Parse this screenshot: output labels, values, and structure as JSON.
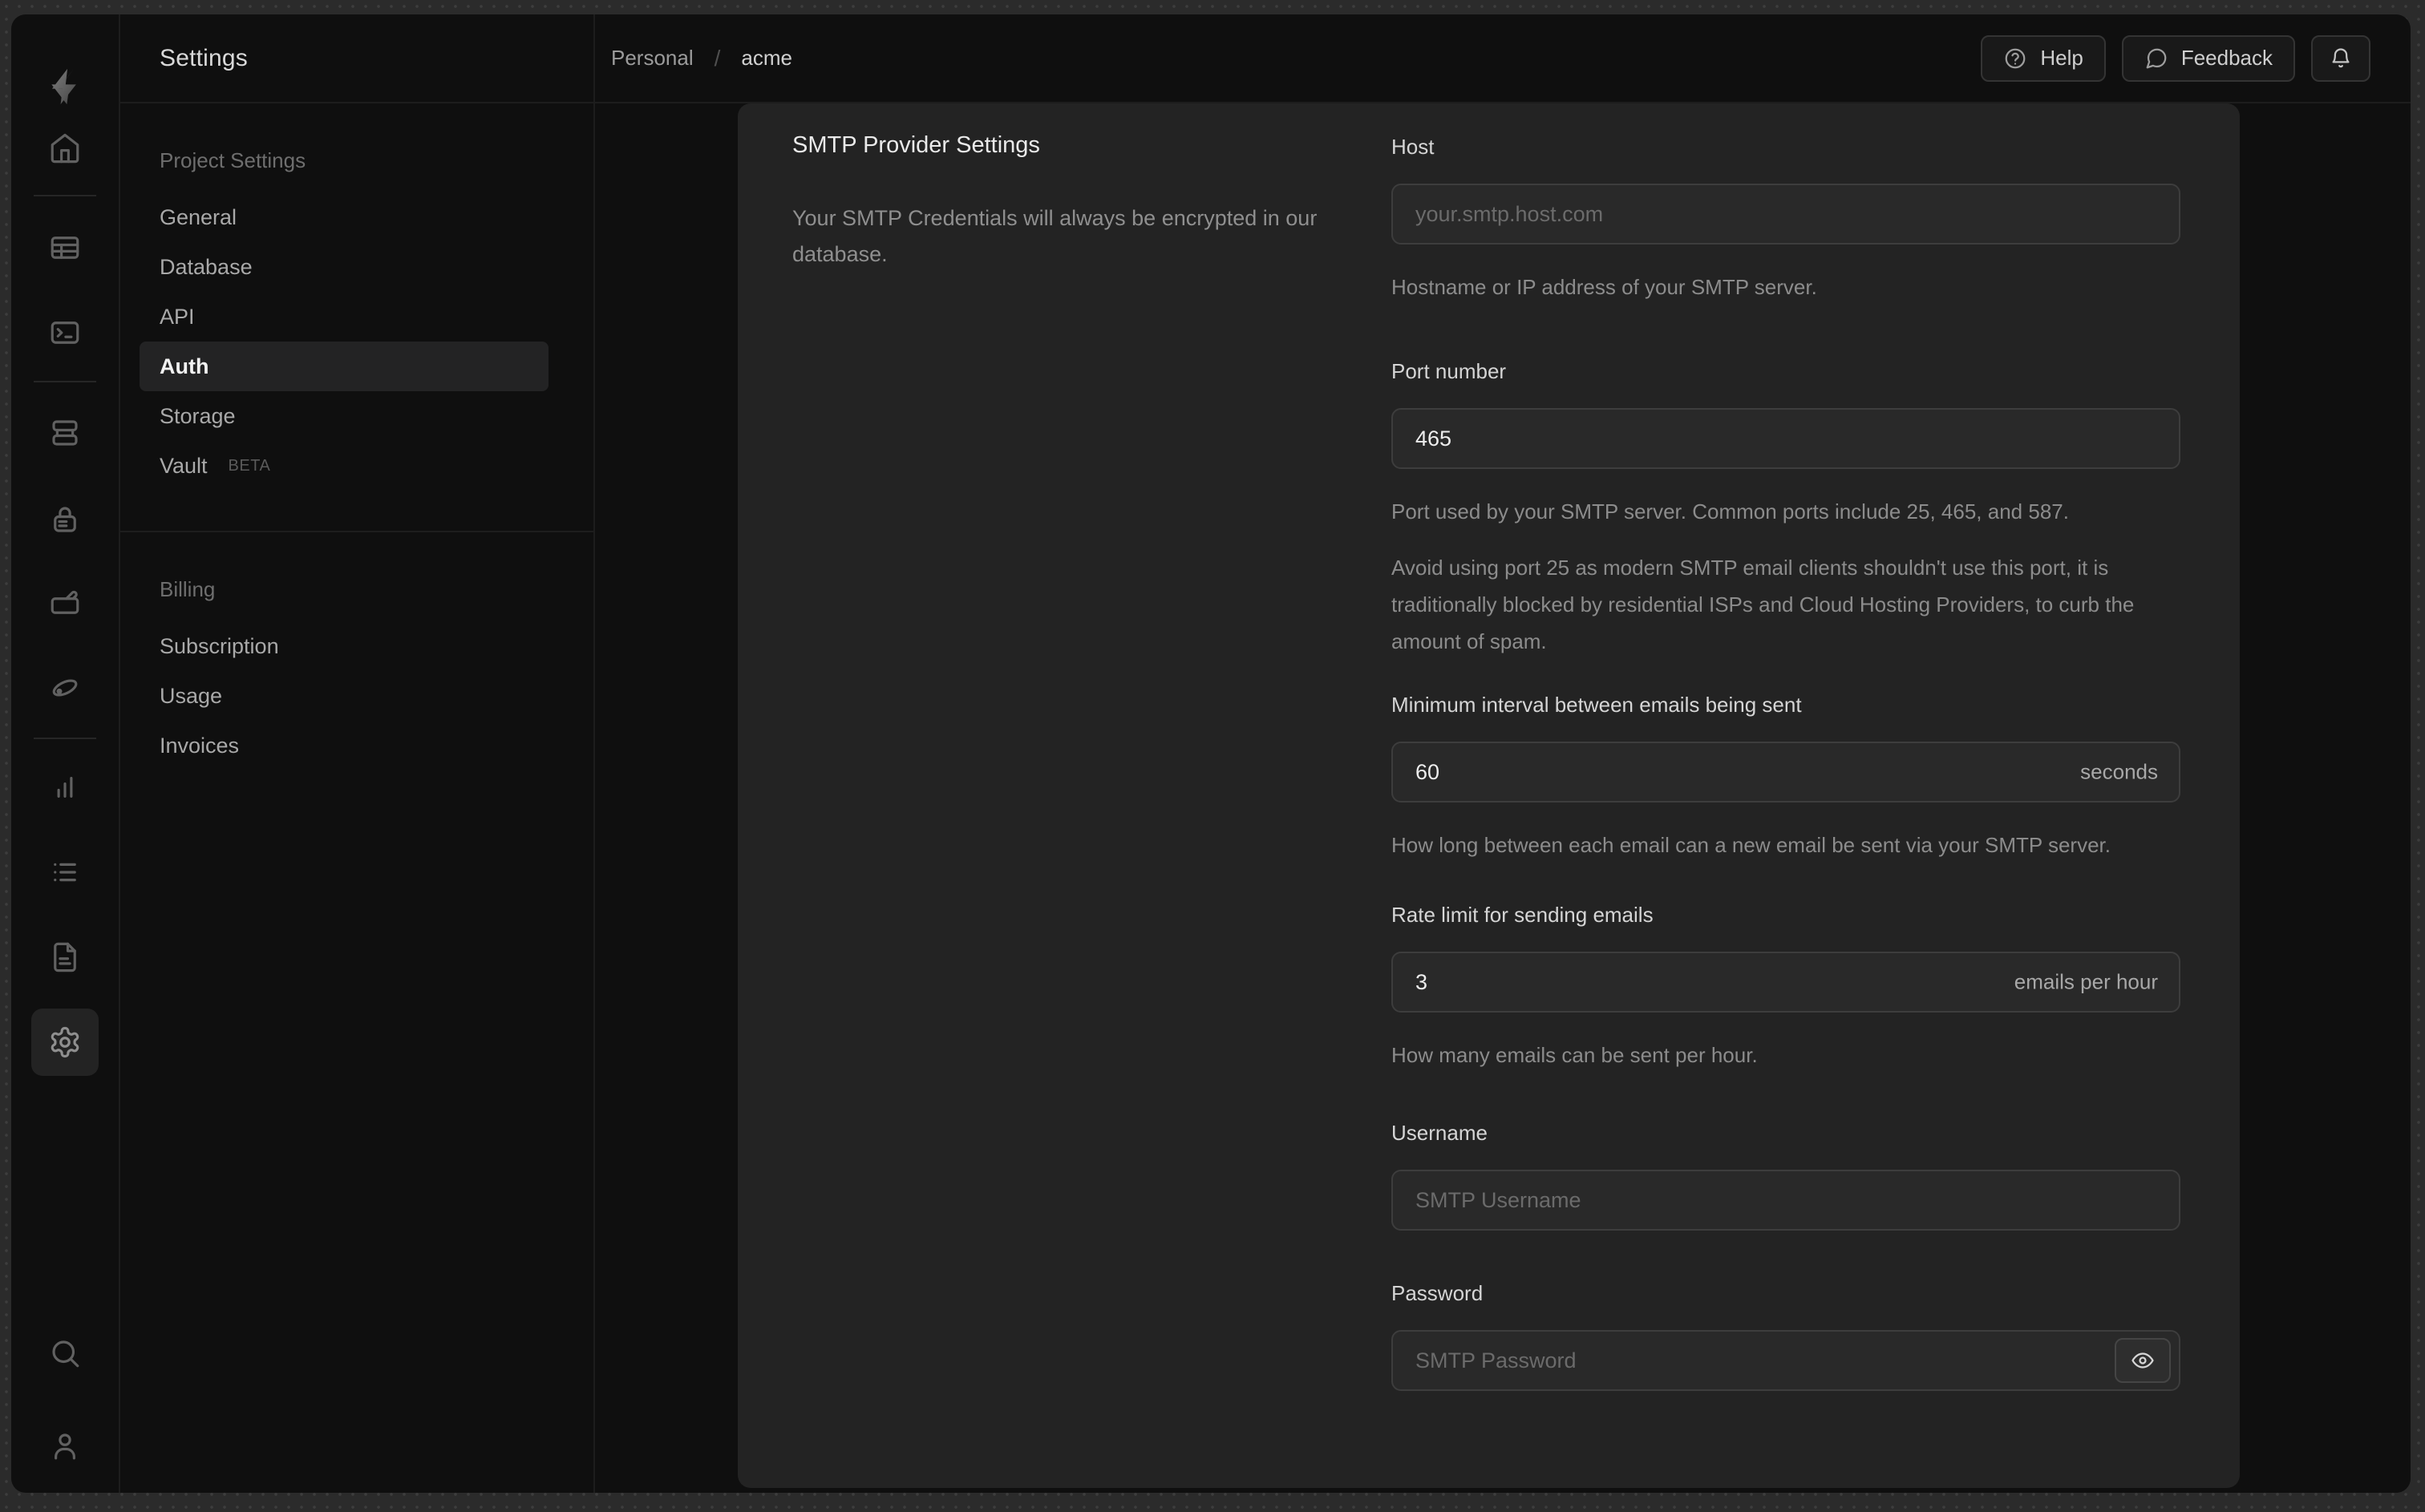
{
  "colors": {
    "desktop": "#2b2b2b",
    "window_bg": "#0f0f0f",
    "card_bg": "#232323",
    "input_bg": "#292929",
    "input_border": "#3d3d3d",
    "divider": "#1d1d1d",
    "text_primary": "#ededed",
    "text_muted": "#8c8c8c",
    "placeholder": "#6b6b6b"
  },
  "icon_rail": {
    "active_item": "project-settings",
    "icons": [
      "supabase-logo",
      "home",
      "table-editor",
      "sql-editor",
      "database",
      "authentication",
      "storage",
      "edge-functions",
      "reports",
      "logs",
      "api-docs",
      "project-settings",
      "search",
      "profile"
    ]
  },
  "sidebar": {
    "title": "Settings",
    "sections": [
      {
        "header": "Project Settings",
        "items": [
          {
            "label": "General"
          },
          {
            "label": "Database"
          },
          {
            "label": "API"
          },
          {
            "label": "Auth",
            "active": true
          },
          {
            "label": "Storage"
          },
          {
            "label": "Vault",
            "badge": "BETA"
          }
        ]
      },
      {
        "header": "Billing",
        "items": [
          {
            "label": "Subscription"
          },
          {
            "label": "Usage"
          },
          {
            "label": "Invoices"
          }
        ]
      }
    ]
  },
  "topbar": {
    "breadcrumb": {
      "org": "Personal",
      "separator": "/",
      "project": "acme"
    },
    "help_label": "Help",
    "feedback_label": "Feedback"
  },
  "panel": {
    "title": "SMTP Provider Settings",
    "description": "Your SMTP Credentials will always be encrypted in our database.",
    "fields": {
      "host": {
        "label": "Host",
        "placeholder": "your.smtp.host.com",
        "helper": "Hostname or IP address of your SMTP server."
      },
      "port": {
        "label": "Port number",
        "value": "465",
        "helper": "Port used by your SMTP server. Common ports include 25, 465, and 587.",
        "note": "Avoid using port 25 as modern SMTP email clients shouldn't use this port, it is traditionally blocked by residential ISPs and Cloud Hosting Providers, to curb the amount of spam."
      },
      "interval": {
        "label": "Minimum interval between emails being sent",
        "value": "60",
        "suffix": "seconds",
        "helper": "How long between each email can a new email be sent via your SMTP server."
      },
      "rate": {
        "label": "Rate limit for sending emails",
        "value": "3",
        "suffix": "emails per hour",
        "helper": "How many emails can be sent per hour."
      },
      "username": {
        "label": "Username",
        "placeholder": "SMTP Username"
      },
      "password": {
        "label": "Password",
        "placeholder": "SMTP Password"
      }
    }
  }
}
